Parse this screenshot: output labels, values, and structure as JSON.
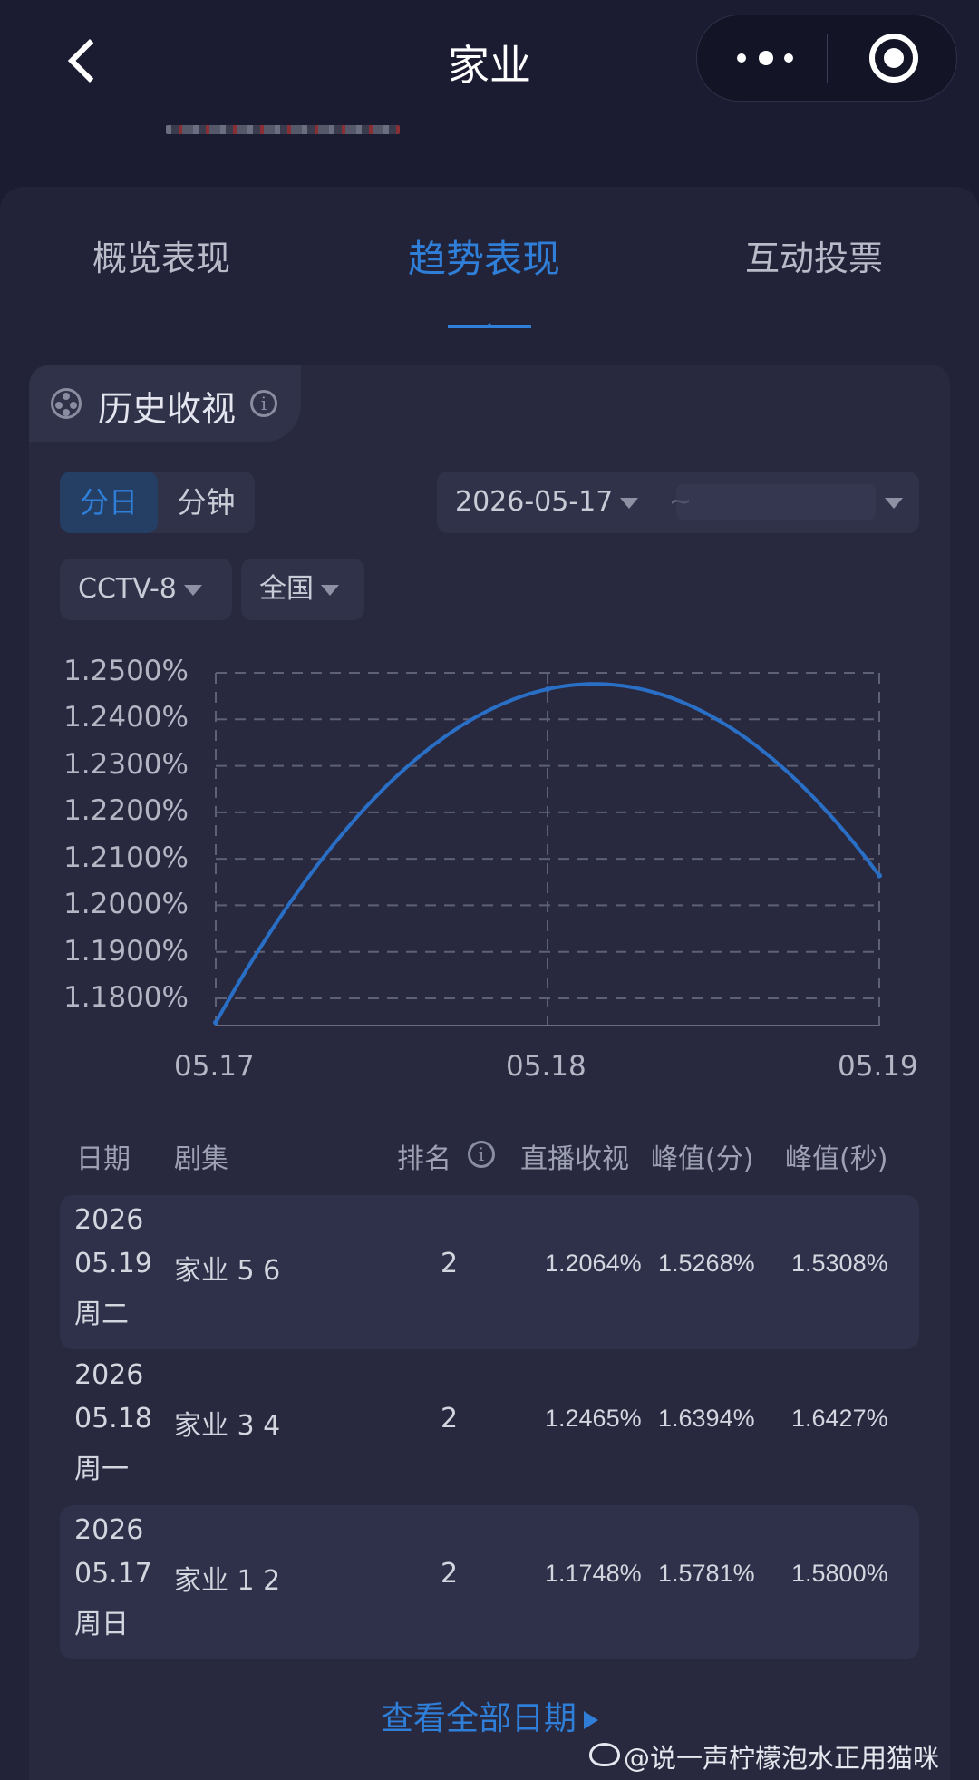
{
  "nav": {
    "title": "家业"
  },
  "tabs": [
    {
      "label": "概览表现"
    },
    {
      "label": "趋势表现"
    },
    {
      "label": "互动投票"
    }
  ],
  "section": {
    "title": "历史收视",
    "info": "i"
  },
  "granularity": {
    "daily": "分日",
    "minute": "分钟"
  },
  "date_range": {
    "start": "2026-05-17",
    "separator": "~"
  },
  "filters": {
    "channel": "CCTV-8",
    "region": "全国"
  },
  "chart_data": {
    "type": "line",
    "x": [
      "05.17",
      "05.18",
      "05.19"
    ],
    "series": [
      {
        "values": [
          1.1748,
          1.2465,
          1.2064
        ]
      }
    ],
    "y_ticks": [
      "1.2500%",
      "1.2400%",
      "1.2300%",
      "1.2200%",
      "1.2100%",
      "1.2000%",
      "1.1900%",
      "1.1800%"
    ],
    "ylim": [
      1.175,
      1.2505
    ],
    "grid": true,
    "line_color": "#2a6fc6",
    "grid_color": "#5e6075"
  },
  "table": {
    "headers": {
      "date": "日期",
      "episode": "剧集",
      "rank": "排名",
      "live": "直播收视",
      "peak_min": "峰值(分)",
      "peak_sec": "峰值(秒)"
    },
    "rows": [
      {
        "year": "2026",
        "date": "05.19",
        "weekday": "周二",
        "episode": "家业 5 6",
        "rank": "2",
        "live": "1.2064%",
        "peak_min": "1.5268%",
        "peak_sec": "1.5308%"
      },
      {
        "year": "2026",
        "date": "05.18",
        "weekday": "周一",
        "episode": "家业 3 4",
        "rank": "2",
        "live": "1.2465%",
        "peak_min": "1.6394%",
        "peak_sec": "1.6427%"
      },
      {
        "year": "2026",
        "date": "05.17",
        "weekday": "周日",
        "episode": "家业 1 2",
        "rank": "2",
        "live": "1.1748%",
        "peak_min": "1.5781%",
        "peak_sec": "1.5800%"
      }
    ]
  },
  "more_link": "查看全部日期",
  "watermark": "@说一声柠檬泡水正用猫咪",
  "colors": {
    "accent": "#2f7ed8",
    "background": "#1b1c31",
    "card": "#28293f"
  }
}
